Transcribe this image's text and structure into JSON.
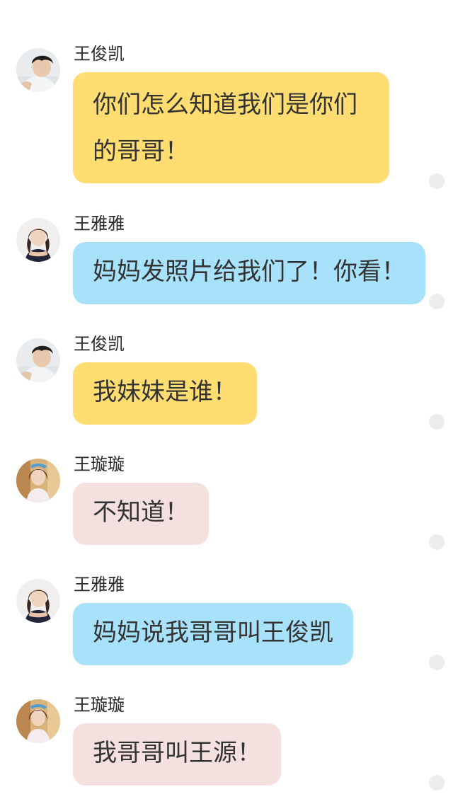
{
  "messages": [
    {
      "sender": "王俊凯",
      "text": "你们怎么知道我们是你们的哥哥！",
      "bubble_color": "#ffdd70",
      "avatar": "boy-avatar"
    },
    {
      "sender": "王雅雅",
      "text": "妈妈发照片给我们了！你看！",
      "bubble_color": "#a7e1fa",
      "avatar": "girl-offshoulder-avatar"
    },
    {
      "sender": "王俊凯",
      "text": "我妹妹是谁！",
      "bubble_color": "#ffdd70",
      "avatar": "boy-avatar"
    },
    {
      "sender": "王璇璇",
      "text": "不知道！",
      "bubble_color": "#f3e0df",
      "avatar": "girl-lace-avatar"
    },
    {
      "sender": "王雅雅",
      "text": "妈妈说我哥哥叫王俊凯",
      "bubble_color": "#a7e1fa",
      "avatar": "girl-offshoulder-avatar"
    },
    {
      "sender": "王璇璇",
      "text": "我哥哥叫王源！",
      "bubble_color": "#f3e0df",
      "avatar": "girl-lace-avatar"
    }
  ]
}
